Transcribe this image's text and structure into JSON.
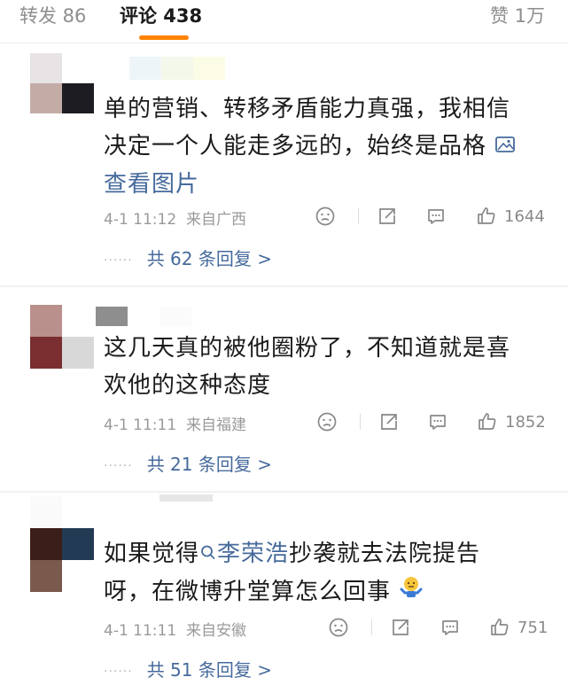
{
  "tabs": {
    "repost": "转发 86",
    "comments": "评论 438",
    "likes": "赞 1万"
  },
  "comments": [
    {
      "text_line1": "单的营销、转移矛盾能力真强，我相信",
      "text_line2": "决定一个人能走多远的，始终是品格",
      "view_image": "查看图片",
      "time": "4-1 11:12",
      "location": "来自广西",
      "likes": "1644",
      "replies_label": "共 62 条回复 >"
    },
    {
      "text_line1": "这几天真的被他圈粉了，不知道就是喜",
      "text_line2": "欢他的这种态度",
      "time": "4-1 11:11",
      "location": "来自福建",
      "likes": "1852",
      "replies_label": "共 21 条回复 >"
    },
    {
      "text_before": "如果觉得",
      "mention": "李荣浩",
      "text_after": "抄袭就去法院提告",
      "text_line2": "呀，在微博升堂算怎么回事",
      "time": "4-1 11:11",
      "location": "来自安徽",
      "likes": "751",
      "replies_label": "共 51 条回复 >"
    }
  ],
  "icons": {
    "dislike": "frown-icon",
    "repost": "repost-icon",
    "comment": "comment-icon",
    "like": "thumbs-up-icon",
    "image": "image-icon",
    "search": "search-icon",
    "emoji": "shrug-emoji-icon"
  },
  "colors": {
    "accent": "#ff8200",
    "link": "#466a9c",
    "muted": "#9a9a9a"
  }
}
